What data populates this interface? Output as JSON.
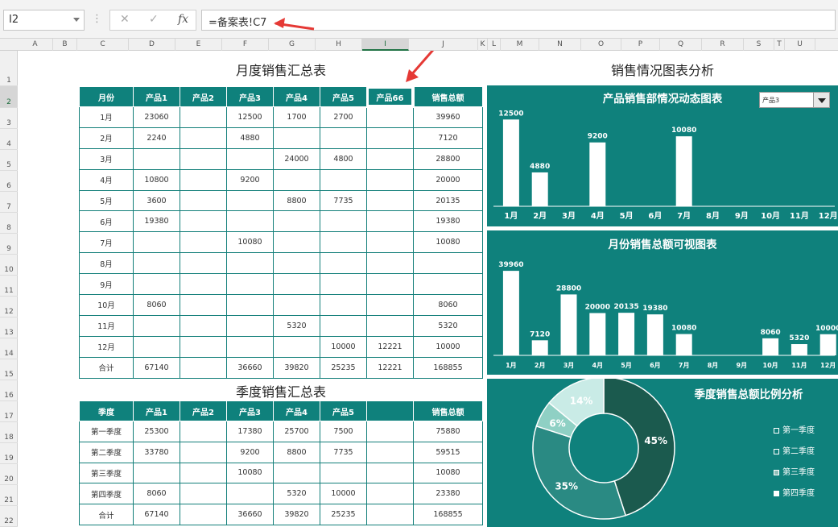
{
  "formula_bar": {
    "name_box": "I2",
    "cancel_glyph": "✕",
    "enter_glyph": "✓",
    "fx_label": "fx",
    "formula": "=备案表!C7"
  },
  "columns": [
    "A",
    "B",
    "C",
    "D",
    "E",
    "F",
    "G",
    "H",
    "I",
    "J",
    "K",
    "L",
    "M",
    "N",
    "O",
    "P",
    "Q",
    "R",
    "S",
    "T",
    "U"
  ],
  "rows": [
    "1",
    "2",
    "3",
    "4",
    "5",
    "6",
    "7",
    "8",
    "9",
    "10",
    "11",
    "12",
    "13",
    "14",
    "15",
    "16",
    "17",
    "18",
    "19",
    "20",
    "21",
    "22"
  ],
  "monthly": {
    "title": "月度销售汇总表",
    "headers": [
      "月份",
      "产品1",
      "产品2",
      "产品3",
      "产品4",
      "产品5",
      "产品66",
      "销售总额"
    ],
    "rows": [
      [
        "1月",
        "23060",
        "",
        "12500",
        "1700",
        "2700",
        "",
        "39960"
      ],
      [
        "2月",
        "2240",
        "",
        "4880",
        "",
        "",
        "",
        "7120"
      ],
      [
        "3月",
        "",
        "",
        "",
        "24000",
        "4800",
        "",
        "28800"
      ],
      [
        "4月",
        "10800",
        "",
        "9200",
        "",
        "",
        "",
        "20000"
      ],
      [
        "5月",
        "3600",
        "",
        "",
        "8800",
        "7735",
        "",
        "20135"
      ],
      [
        "6月",
        "19380",
        "",
        "",
        "",
        "",
        "",
        "19380"
      ],
      [
        "7月",
        "",
        "",
        "10080",
        "",
        "",
        "",
        "10080"
      ],
      [
        "8月",
        "",
        "",
        "",
        "",
        "",
        "",
        ""
      ],
      [
        "9月",
        "",
        "",
        "",
        "",
        "",
        "",
        ""
      ],
      [
        "10月",
        "8060",
        "",
        "",
        "",
        "",
        "",
        "8060"
      ],
      [
        "11月",
        "",
        "",
        "",
        "5320",
        "",
        "",
        "5320"
      ],
      [
        "12月",
        "",
        "",
        "",
        "",
        "10000",
        "12221",
        "10000"
      ],
      [
        "合计",
        "67140",
        "",
        "36660",
        "39820",
        "25235",
        "12221",
        "168855"
      ]
    ]
  },
  "quarterly": {
    "title": "季度销售汇总表",
    "headers": [
      "季度",
      "产品1",
      "产品2",
      "产品3",
      "产品4",
      "产品5",
      "",
      "销售总额"
    ],
    "rows": [
      [
        "第一季度",
        "25300",
        "",
        "17380",
        "25700",
        "7500",
        "",
        "75880"
      ],
      [
        "第二季度",
        "33780",
        "",
        "9200",
        "8800",
        "7735",
        "",
        "59515"
      ],
      [
        "第三季度",
        "",
        "",
        "10080",
        "",
        "",
        "",
        "10080"
      ],
      [
        "第四季度",
        "8060",
        "",
        "",
        "5320",
        "10000",
        "",
        "23380"
      ],
      [
        "合计",
        "67140",
        "",
        "36660",
        "39820",
        "25235",
        "",
        "168855"
      ]
    ]
  },
  "analysis_title": "销售情况图表分析",
  "colors": {
    "teal": "#0f817c",
    "dark_teal": "#1b5a4e",
    "bar": "#ffffff"
  },
  "chart_data": [
    {
      "type": "bar",
      "title": "产品销售部情况动态图表",
      "dropdown_value": "产品3",
      "categories": [
        "1月",
        "2月",
        "3月",
        "4月",
        "5月",
        "6月",
        "7月",
        "8月",
        "9月",
        "10月",
        "11月",
        "12月"
      ],
      "values": [
        12500,
        4880,
        null,
        9200,
        null,
        null,
        10080,
        null,
        null,
        null,
        null,
        null
      ],
      "data_labels": [
        "12500",
        "4880",
        "",
        "9200",
        "",
        "",
        "10080",
        "",
        "",
        "",
        "",
        ""
      ],
      "ylim": [
        0,
        13000
      ],
      "grid": false
    },
    {
      "type": "bar",
      "title": "月份销售总额可视图表",
      "categories": [
        "1月",
        "2月",
        "3月",
        "4月",
        "5月",
        "6月",
        "7月",
        "8月",
        "9月",
        "10月",
        "11月",
        "12月"
      ],
      "values": [
        39960,
        7120,
        28800,
        20000,
        20135,
        19380,
        10080,
        null,
        null,
        8060,
        5320,
        10000
      ],
      "data_labels": [
        "39960",
        "7120",
        "28800",
        "20000",
        "20135",
        "19380",
        "10080",
        "",
        "",
        "8060",
        "5320",
        "10000"
      ],
      "ylim": [
        0,
        40000
      ],
      "grid": false
    },
    {
      "type": "pie",
      "title": "季度销售总额比例分析",
      "categories": [
        "第一季度",
        "第二季度",
        "第三季度",
        "第四季度"
      ],
      "values": [
        45,
        35,
        6,
        14
      ],
      "labels": [
        "45%",
        "35%",
        "6%",
        "14%"
      ],
      "colors": [
        "#1b5a4e",
        "#2a8a83",
        "#8fd0c4",
        "#c9ebe6"
      ],
      "legend": "right"
    }
  ]
}
